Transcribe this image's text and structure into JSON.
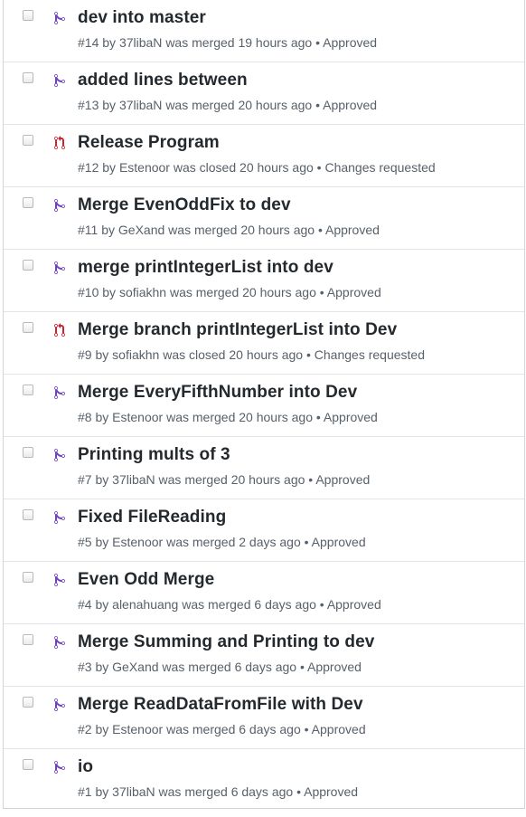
{
  "colors": {
    "merged": "#6f42c1",
    "closed": "#cb2431",
    "text": "#24292e",
    "meta": "#586069"
  },
  "pull_requests": [
    {
      "title": "dev into master",
      "number": "#14",
      "author": "37libaN",
      "action": "was merged",
      "time": "19 hours ago",
      "review": "Approved",
      "state": "merged",
      "icon": "git-merge-icon"
    },
    {
      "title": "added lines between",
      "number": "#13",
      "author": "37libaN",
      "action": "was merged",
      "time": "20 hours ago",
      "review": "Approved",
      "state": "merged",
      "icon": "git-merge-icon"
    },
    {
      "title": "Release Program",
      "number": "#12",
      "author": "Estenoor",
      "action": "was closed",
      "time": "20 hours ago",
      "review": "Changes requested",
      "state": "closed",
      "icon": "git-pull-request-closed-icon"
    },
    {
      "title": "Merge EvenOddFix to dev",
      "number": "#11",
      "author": "GeXand",
      "action": "was merged",
      "time": "20 hours ago",
      "review": "Approved",
      "state": "merged",
      "icon": "git-merge-icon"
    },
    {
      "title": "merge printIntegerList into dev",
      "number": "#10",
      "author": "sofiakhn",
      "action": "was merged",
      "time": "20 hours ago",
      "review": "Approved",
      "state": "merged",
      "icon": "git-merge-icon"
    },
    {
      "title": "Merge branch printIntegerList into Dev",
      "number": "#9",
      "author": "sofiakhn",
      "action": "was closed",
      "time": "20 hours ago",
      "review": "Changes requested",
      "state": "closed",
      "icon": "git-pull-request-closed-icon"
    },
    {
      "title": "Merge EveryFifthNumber into Dev",
      "number": "#8",
      "author": "Estenoor",
      "action": "was merged",
      "time": "20 hours ago",
      "review": "Approved",
      "state": "merged",
      "icon": "git-merge-icon"
    },
    {
      "title": "Printing mults of 3",
      "number": "#7",
      "author": "37libaN",
      "action": "was merged",
      "time": "20 hours ago",
      "review": "Approved",
      "state": "merged",
      "icon": "git-merge-icon"
    },
    {
      "title": "Fixed FileReading",
      "number": "#5",
      "author": "Estenoor",
      "action": "was merged",
      "time": "2 days ago",
      "review": "Approved",
      "state": "merged",
      "icon": "git-merge-icon"
    },
    {
      "title": "Even Odd Merge",
      "number": "#4",
      "author": "alenahuang",
      "action": "was merged",
      "time": "6 days ago",
      "review": "Approved",
      "state": "merged",
      "icon": "git-merge-icon"
    },
    {
      "title": "Merge Summing and Printing to dev",
      "number": "#3",
      "author": "GeXand",
      "action": "was merged",
      "time": "6 days ago",
      "review": "Approved",
      "state": "merged",
      "icon": "git-merge-icon"
    },
    {
      "title": "Merge ReadDataFromFile with Dev",
      "number": "#2",
      "author": "Estenoor",
      "action": "was merged",
      "time": "6 days ago",
      "review": "Approved",
      "state": "merged",
      "icon": "git-merge-icon"
    },
    {
      "title": "io",
      "number": "#1",
      "author": "37libaN",
      "action": "was merged",
      "time": "6 days ago",
      "review": "Approved",
      "state": "merged",
      "icon": "git-merge-icon"
    }
  ]
}
